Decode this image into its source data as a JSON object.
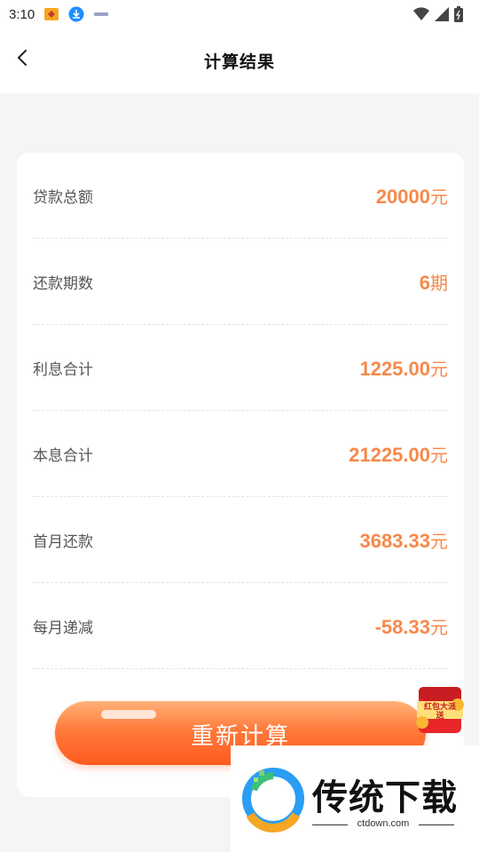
{
  "status_bar": {
    "time": "3:10",
    "icons": [
      "app-notification-icon",
      "download-icon",
      "app-small-icon",
      "wifi-icon",
      "signal-icon",
      "battery-icon"
    ]
  },
  "nav": {
    "title": "计算结果",
    "back_icon": "chevron-left-icon"
  },
  "results": [
    {
      "label": "贷款总额",
      "value": "20000",
      "unit": "元"
    },
    {
      "label": "还款期数",
      "value": "6",
      "unit": "期"
    },
    {
      "label": "利息合计",
      "value": "1225.00",
      "unit": "元"
    },
    {
      "label": "本息合计",
      "value": "21225.00",
      "unit": "元"
    },
    {
      "label": "首月还款",
      "value": "3683.33",
      "unit": "元"
    },
    {
      "label": "每月递减",
      "value": "-58.33",
      "unit": "元"
    }
  ],
  "action": {
    "recalculate_label": "重新计算"
  },
  "red_packet": {
    "label": "红包大派送"
  },
  "watermark": {
    "title": "传统下载",
    "domain": "ctdown.com"
  },
  "colors": {
    "accent": "#f6894a",
    "button_start": "#ffb27a",
    "button_end": "#ff5a1f",
    "background": "#f5f5f5"
  }
}
